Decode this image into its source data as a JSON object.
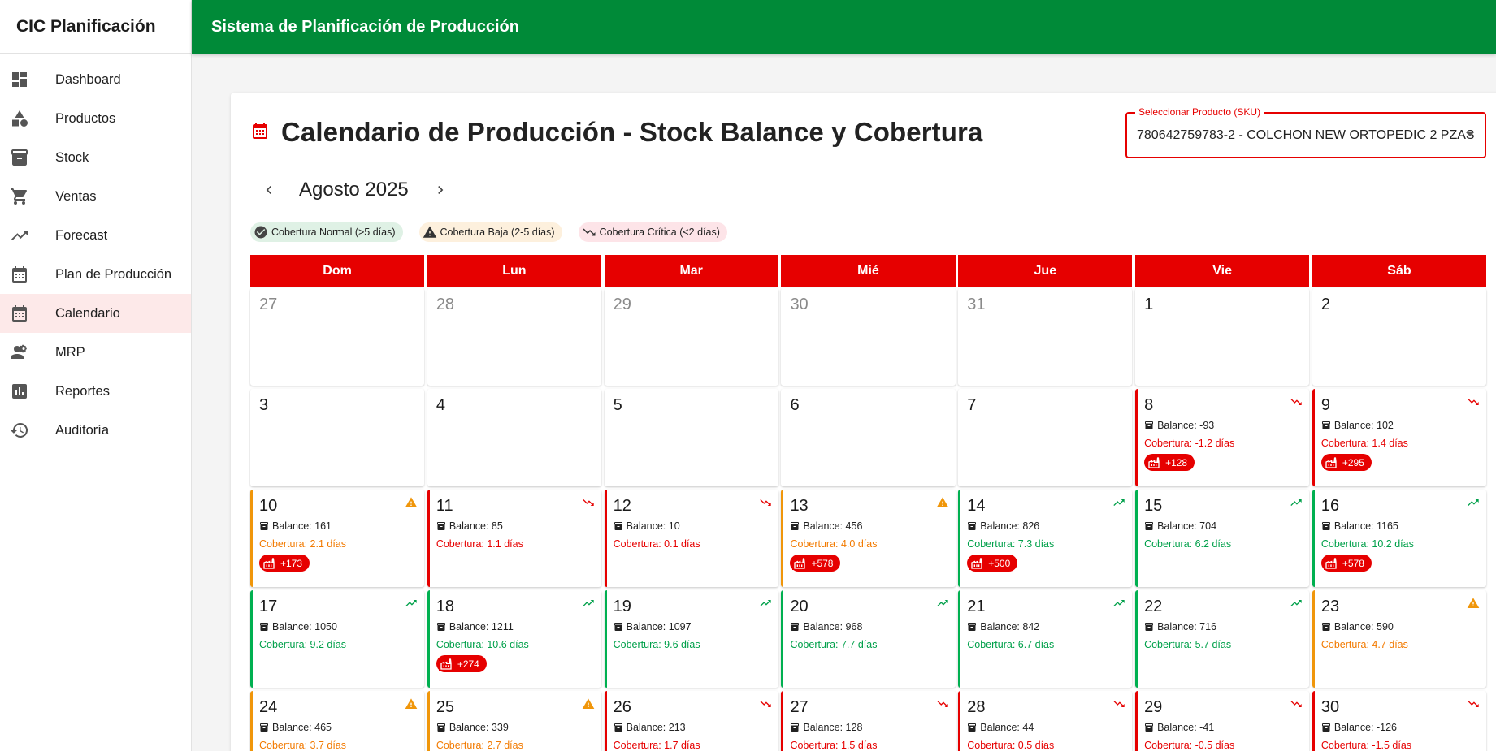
{
  "app": {
    "brand": "CIC Planificación",
    "topbar_title": "Sistema de Planificación de Producción"
  },
  "sidebar": {
    "items": [
      {
        "label": "Dashboard",
        "icon": "dashboard-icon",
        "active": false
      },
      {
        "label": "Productos",
        "icon": "category-icon",
        "active": false
      },
      {
        "label": "Stock",
        "icon": "inventory-box-icon",
        "active": false
      },
      {
        "label": "Ventas",
        "icon": "cart-icon",
        "active": false
      },
      {
        "label": "Forecast",
        "icon": "trending-up-icon",
        "active": false
      },
      {
        "label": "Plan de Producción",
        "icon": "calendar-icon",
        "active": false
      },
      {
        "label": "Calendario",
        "icon": "calendar-icon",
        "active": true
      },
      {
        "label": "MRP",
        "icon": "people-gear-icon",
        "active": false
      },
      {
        "label": "Reportes",
        "icon": "bar-chart-icon",
        "active": false
      },
      {
        "label": "Auditoría",
        "icon": "history-icon",
        "active": false
      }
    ]
  },
  "page": {
    "title": "Calendario de Producción - Stock Balance y Cobertura",
    "sku_label": "Seleccionar Producto (SKU)",
    "sku_value": "780642759783-2 - COLCHON NEW ORTOPEDIC 2 PZAS",
    "month_label": "Agosto 2025"
  },
  "legend": {
    "normal": "Cobertura Normal (>5 días)",
    "baja": "Cobertura Baja (2-5 días)",
    "critica": "Cobertura Crítica (<2 días)"
  },
  "colors": {
    "primary_red": "#e60000",
    "topbar_green": "#008a38",
    "normal": "#00a04a",
    "baja": "#f0960a",
    "critica": "#e60000"
  },
  "weekdays": [
    "Dom",
    "Lun",
    "Mar",
    "Mié",
    "Jue",
    "Vie",
    "Sáb"
  ],
  "days": [
    {
      "day": "27",
      "other": true
    },
    {
      "day": "28",
      "other": true
    },
    {
      "day": "29",
      "other": true
    },
    {
      "day": "30",
      "other": true
    },
    {
      "day": "31",
      "other": true
    },
    {
      "day": "1"
    },
    {
      "day": "2"
    },
    {
      "day": "3"
    },
    {
      "day": "4"
    },
    {
      "day": "5"
    },
    {
      "day": "6"
    },
    {
      "day": "7"
    },
    {
      "day": "8",
      "status": "critica",
      "balance": "Balance: -93",
      "cobertura": "Cobertura: -1.2 días",
      "produccion": "+128"
    },
    {
      "day": "9",
      "status": "critica",
      "balance": "Balance: 102",
      "cobertura": "Cobertura: 1.4 días",
      "produccion": "+295"
    },
    {
      "day": "10",
      "status": "baja",
      "balance": "Balance: 161",
      "cobertura": "Cobertura: 2.1 días",
      "produccion": "+173"
    },
    {
      "day": "11",
      "status": "critica",
      "balance": "Balance: 85",
      "cobertura": "Cobertura: 1.1 días"
    },
    {
      "day": "12",
      "status": "critica",
      "balance": "Balance: 10",
      "cobertura": "Cobertura: 0.1 días"
    },
    {
      "day": "13",
      "status": "baja",
      "balance": "Balance: 456",
      "cobertura": "Cobertura: 4.0 días",
      "produccion": "+578"
    },
    {
      "day": "14",
      "status": "normal",
      "balance": "Balance: 826",
      "cobertura": "Cobertura: 7.3 días",
      "produccion": "+500"
    },
    {
      "day": "15",
      "status": "normal",
      "balance": "Balance: 704",
      "cobertura": "Cobertura: 6.2 días"
    },
    {
      "day": "16",
      "status": "normal",
      "balance": "Balance: 1165",
      "cobertura": "Cobertura: 10.2 días",
      "produccion": "+578"
    },
    {
      "day": "17",
      "status": "normal",
      "balance": "Balance: 1050",
      "cobertura": "Cobertura: 9.2 días"
    },
    {
      "day": "18",
      "status": "normal",
      "balance": "Balance: 1211",
      "cobertura": "Cobertura: 10.6 días",
      "produccion": "+274"
    },
    {
      "day": "19",
      "status": "normal",
      "balance": "Balance: 1097",
      "cobertura": "Cobertura: 9.6 días"
    },
    {
      "day": "20",
      "status": "normal",
      "balance": "Balance: 968",
      "cobertura": "Cobertura: 7.7 días"
    },
    {
      "day": "21",
      "status": "normal",
      "balance": "Balance: 842",
      "cobertura": "Cobertura: 6.7 días"
    },
    {
      "day": "22",
      "status": "normal",
      "balance": "Balance: 716",
      "cobertura": "Cobertura: 5.7 días"
    },
    {
      "day": "23",
      "status": "baja",
      "balance": "Balance: 590",
      "cobertura": "Cobertura: 4.7 días"
    },
    {
      "day": "24",
      "status": "baja",
      "balance": "Balance: 465",
      "cobertura": "Cobertura: 3.7 días"
    },
    {
      "day": "25",
      "status": "baja",
      "balance": "Balance: 339",
      "cobertura": "Cobertura: 2.7 días"
    },
    {
      "day": "26",
      "status": "critica",
      "balance": "Balance: 213",
      "cobertura": "Cobertura: 1.7 días"
    },
    {
      "day": "27",
      "status": "critica",
      "balance": "Balance: 128",
      "cobertura": "Cobertura: 1.5 días"
    },
    {
      "day": "28",
      "status": "critica",
      "balance": "Balance: 44",
      "cobertura": "Cobertura: 0.5 días"
    },
    {
      "day": "29",
      "status": "critica",
      "balance": "Balance: -41",
      "cobertura": "Cobertura: -0.5 días"
    },
    {
      "day": "30",
      "status": "critica",
      "balance": "Balance: -126",
      "cobertura": "Cobertura: -1.5 días"
    }
  ]
}
